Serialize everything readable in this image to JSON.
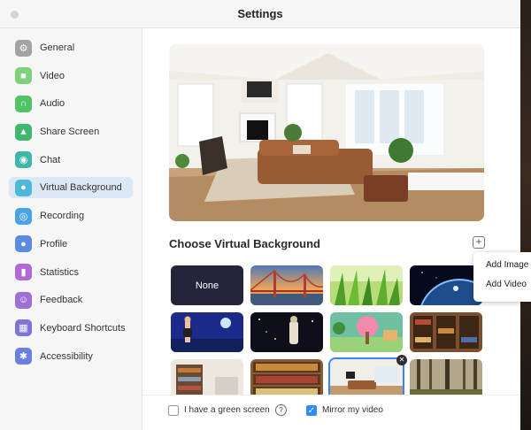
{
  "window": {
    "title": "Settings"
  },
  "sidebar": {
    "items": [
      {
        "label": "General",
        "icon": "gear-icon",
        "color": "#a3a3a3",
        "glyph": "⚙"
      },
      {
        "label": "Video",
        "icon": "video-camera-icon",
        "color": "#7ed27a",
        "glyph": "■"
      },
      {
        "label": "Audio",
        "icon": "headphones-icon",
        "color": "#4fc466",
        "glyph": "∩"
      },
      {
        "label": "Share Screen",
        "icon": "share-screen-icon",
        "color": "#3fb86e",
        "glyph": "▲"
      },
      {
        "label": "Chat",
        "icon": "chat-bubble-icon",
        "color": "#3cb7a8",
        "glyph": "◉"
      },
      {
        "label": "Virtual Background",
        "icon": "person-background-icon",
        "color": "#4fb8d9",
        "glyph": "●",
        "active": true
      },
      {
        "label": "Recording",
        "icon": "record-icon",
        "color": "#4aa3e6",
        "glyph": "◎"
      },
      {
        "label": "Profile",
        "icon": "profile-icon",
        "color": "#5a8be0",
        "glyph": "●"
      },
      {
        "label": "Statistics",
        "icon": "bar-chart-icon",
        "color": "#b06ad4",
        "glyph": "▮"
      },
      {
        "label": "Feedback",
        "icon": "smiley-icon",
        "color": "#a06fd6",
        "glyph": "☺"
      },
      {
        "label": "Keyboard Shortcuts",
        "icon": "keyboard-icon",
        "color": "#7f72d9",
        "glyph": "▦"
      },
      {
        "label": "Accessibility",
        "icon": "accessibility-icon",
        "color": "#6b7fe0",
        "glyph": "✱"
      }
    ]
  },
  "main": {
    "section_title": "Choose Virtual Background",
    "add_button": "+",
    "popup": {
      "add_image": "Add Image",
      "add_video": "Add Video"
    },
    "none_label": "None",
    "close_glyph": "✕",
    "backgrounds": [
      {
        "name": "golden-gate-bridge"
      },
      {
        "name": "grass"
      },
      {
        "name": "earth-from-space"
      },
      {
        "name": "concert-stage"
      },
      {
        "name": "space-concert"
      },
      {
        "name": "animal-crossing-island"
      },
      {
        "name": "library-shelves"
      },
      {
        "name": "bookshelf-office"
      },
      {
        "name": "bookcase"
      },
      {
        "name": "living-room",
        "selected": true
      },
      {
        "name": "misty-forest"
      }
    ]
  },
  "footer": {
    "green_screen_label": "I have a green screen",
    "green_screen_checked": false,
    "help_glyph": "?",
    "mirror_label": "Mirror my video",
    "mirror_checked": true,
    "check_glyph": "✓"
  }
}
